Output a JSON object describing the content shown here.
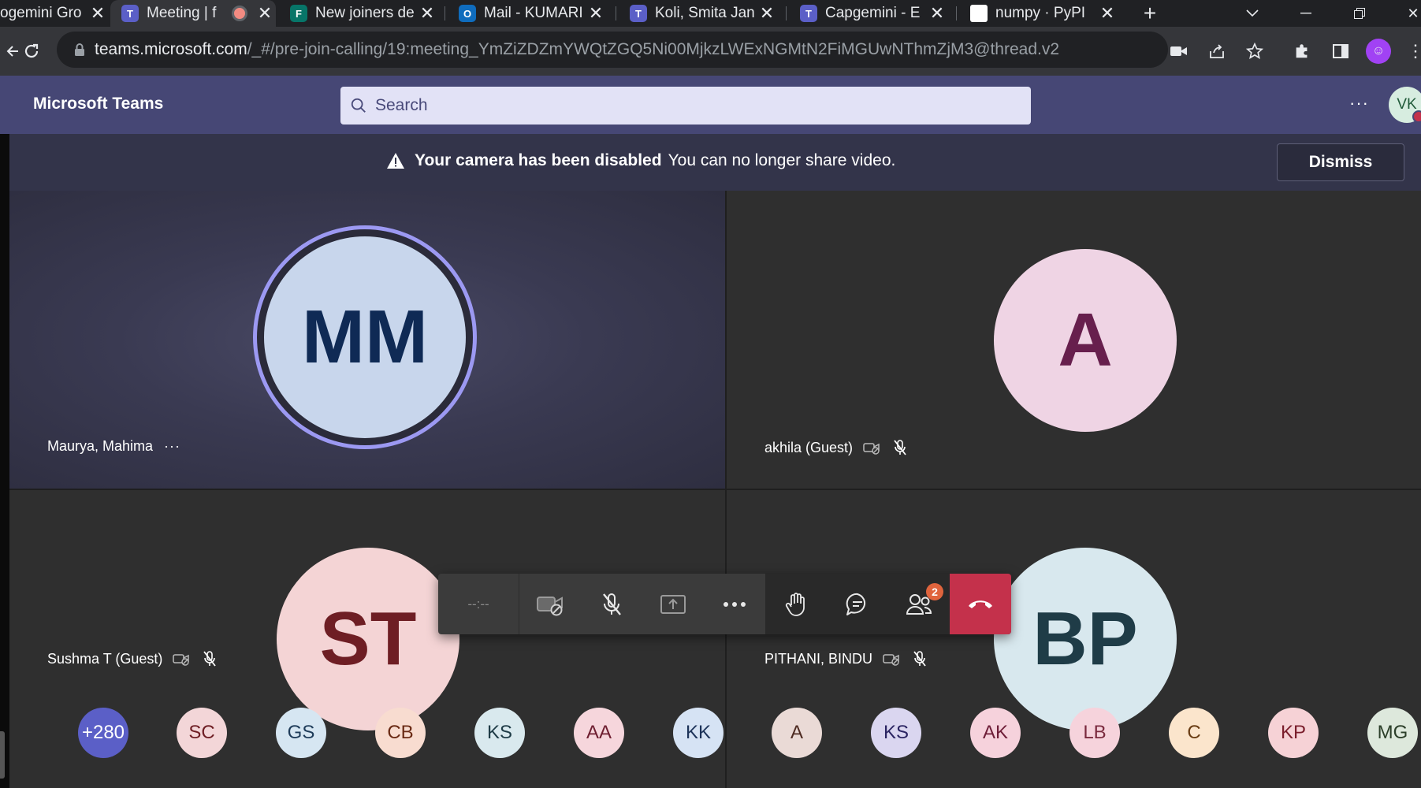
{
  "browser": {
    "tabs": [
      {
        "title": "ogemini Gro",
        "icon": "capgemini-icon"
      },
      {
        "title": "Meeting | f",
        "icon": "teams-icon",
        "recording": true
      },
      {
        "title": "New joiners de",
        "icon": "forms-icon"
      },
      {
        "title": "Mail - KUMARI",
        "icon": "outlook-icon"
      },
      {
        "title": "Koli, Smita Jan",
        "icon": "teams-icon"
      },
      {
        "title": "Capgemini - E",
        "icon": "teams-icon"
      },
      {
        "title": "numpy · PyPI",
        "icon": "pypi-icon"
      }
    ],
    "url_host": "teams.microsoft.com",
    "url_path": "/_#/pre-join-calling/19:meeting_YmZiZDZmYWQtZGQ5Ni00MjkzLWExNGMtN2FiMGUwNThmZjM3@thread.v2"
  },
  "teams": {
    "app_title": "Microsoft Teams",
    "search_placeholder": "Search",
    "more_label": "···",
    "user_initials": "VK"
  },
  "notice": {
    "title": "Your camera has been disabled",
    "message": "You can no longer share video.",
    "dismiss_label": "Dismiss"
  },
  "tiles": [
    {
      "initials": "MM",
      "name": "Maurya, Mahima",
      "more": "···",
      "speaking": true
    },
    {
      "initials": "A",
      "name": "akhila (Guest)",
      "muted": true
    },
    {
      "initials": "ST",
      "name": "Sushma T (Guest)",
      "muted": true
    },
    {
      "initials": "BP",
      "name": "PITHANI, BINDU",
      "muted": true
    }
  ],
  "toolbar": {
    "timer": "--:--",
    "participants_badge": "2"
  },
  "strip": {
    "overflow_label": "+280",
    "participants": [
      {
        "initials": "SC",
        "bg": "#f3d6d8",
        "fg": "#6e1e24"
      },
      {
        "initials": "GS",
        "bg": "#d6e6f2",
        "fg": "#1f3c5a"
      },
      {
        "initials": "CB",
        "bg": "#f8dcd0",
        "fg": "#6a2a14"
      },
      {
        "initials": "KS",
        "bg": "#d9e9ee",
        "fg": "#1f3c47"
      },
      {
        "initials": "AA",
        "bg": "#f6d6dc",
        "fg": "#6e1e30"
      },
      {
        "initials": "KK",
        "bg": "#d6e3f4",
        "fg": "#1d3359"
      },
      {
        "initials": "A",
        "bg": "#eadad6",
        "fg": "#4e2b22"
      },
      {
        "initials": "KS",
        "bg": "#dad6f0",
        "fg": "#2b2462"
      },
      {
        "initials": "AK",
        "bg": "#f6d2dc",
        "fg": "#6e1e38"
      },
      {
        "initials": "LB",
        "bg": "#f6d3dc",
        "fg": "#7a2a3e"
      },
      {
        "initials": "C",
        "bg": "#fbe5cc",
        "fg": "#6a3d14"
      },
      {
        "initials": "KP",
        "bg": "#f6d2d6",
        "fg": "#7a1e2c"
      },
      {
        "initials": "MG",
        "bg": "#dde8dc",
        "fg": "#2c3f2a"
      }
    ]
  }
}
